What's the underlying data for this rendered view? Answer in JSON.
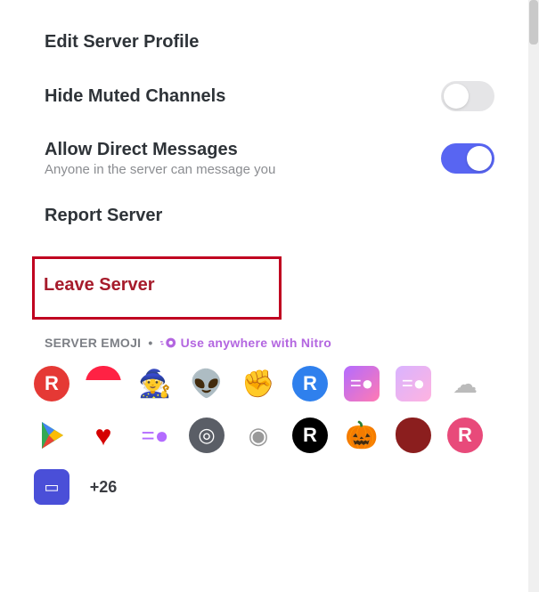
{
  "menu": {
    "edit_profile": "Edit Server Profile",
    "hide_muted": "Hide Muted Channels",
    "allow_dm_title": "Allow Direct Messages",
    "allow_dm_sub": "Anyone in the server can message you",
    "report": "Report Server",
    "leave": "Leave Server"
  },
  "toggles": {
    "hide_muted": false,
    "allow_dm": true
  },
  "emoji_section": {
    "header": "SERVER EMOJI",
    "dot": "•",
    "nitro_text": "Use anywhere with Nitro",
    "more_count": "+26"
  },
  "emojis_row1": [
    {
      "name": "red-r",
      "glyph": "R"
    },
    {
      "name": "mushroom",
      "glyph": "◠"
    },
    {
      "name": "wizard",
      "glyph": "🧙"
    },
    {
      "name": "alien",
      "glyph": "👽"
    },
    {
      "name": "fist",
      "glyph": "✊"
    },
    {
      "name": "blue-r",
      "glyph": "R"
    },
    {
      "name": "nitro-pink",
      "glyph": "=●"
    },
    {
      "name": "nitro-light",
      "glyph": "=●"
    },
    {
      "name": "ghost",
      "glyph": "☁"
    },
    {
      "name": "play",
      "glyph": "▶"
    }
  ],
  "emojis_row2": [
    {
      "name": "heart",
      "glyph": "♥"
    },
    {
      "name": "swirl",
      "glyph": "=●"
    },
    {
      "name": "target",
      "glyph": "◎"
    },
    {
      "name": "eye",
      "glyph": "◉"
    },
    {
      "name": "black-r",
      "glyph": "R"
    },
    {
      "name": "pumpkin",
      "glyph": "🎃"
    },
    {
      "name": "blob",
      "glyph": ""
    },
    {
      "name": "pink-r",
      "glyph": "R"
    },
    {
      "name": "bluebox",
      "glyph": "▭"
    }
  ]
}
